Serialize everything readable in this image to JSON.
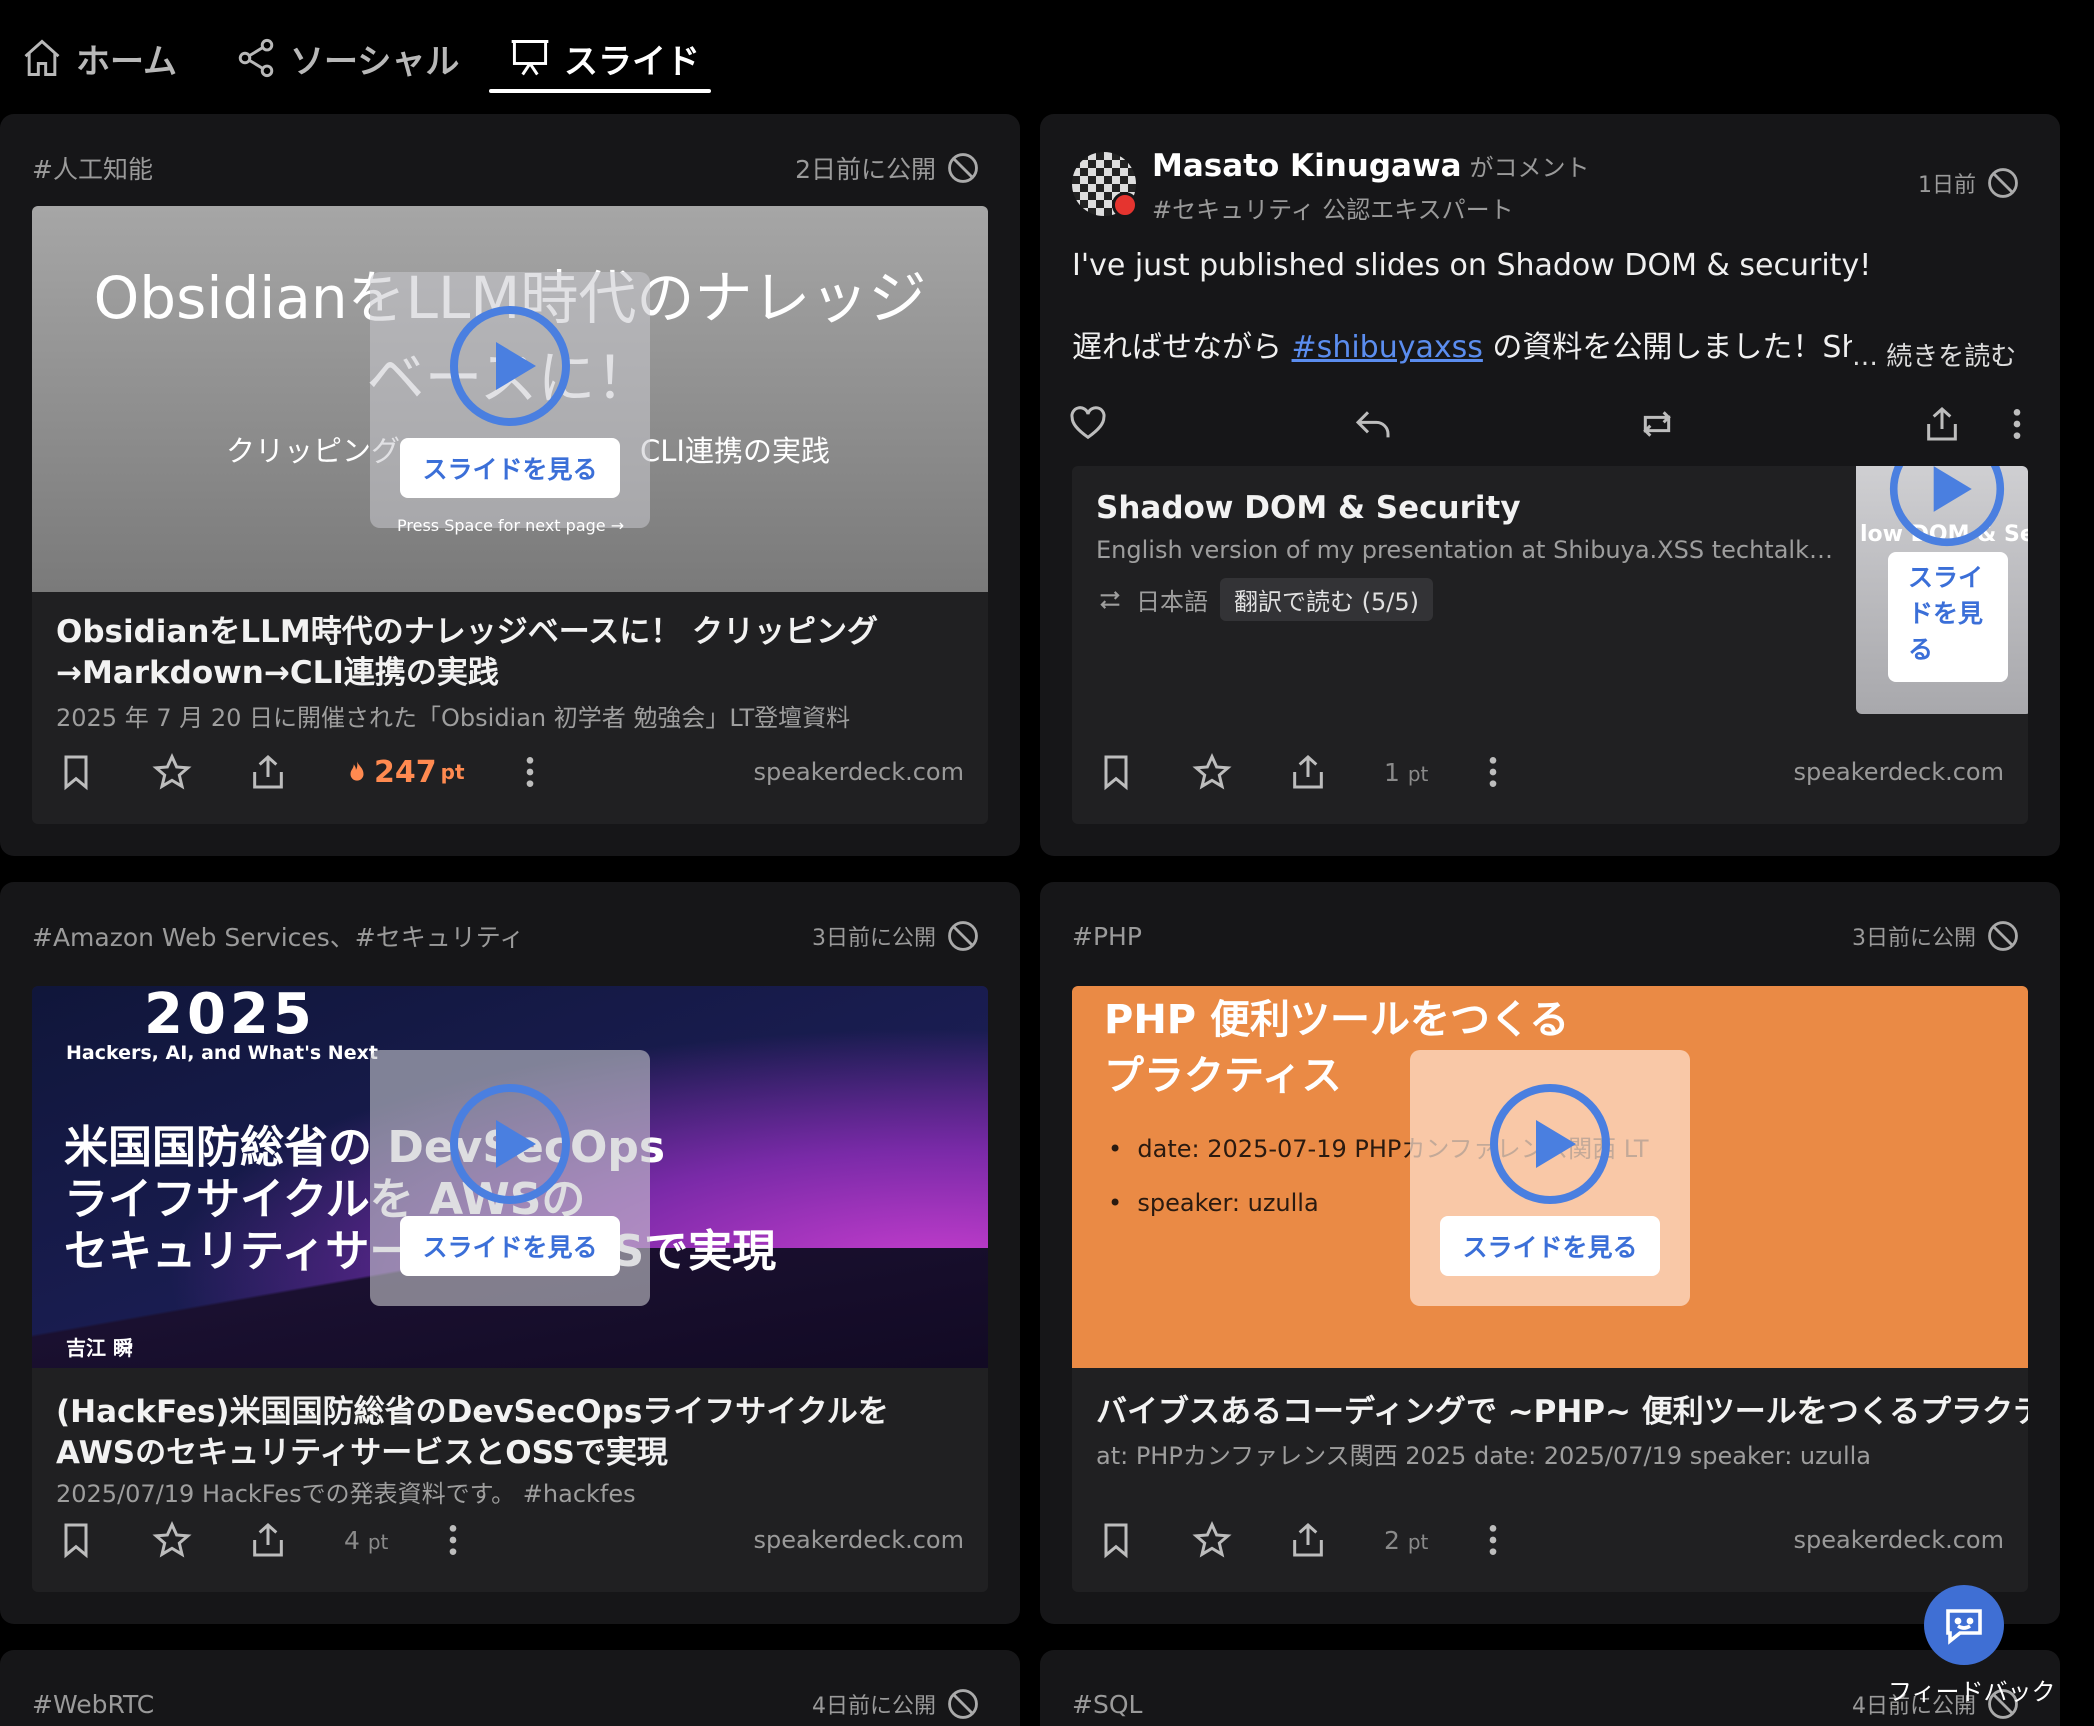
{
  "nav": {
    "tabs": [
      {
        "label": "ホーム",
        "icon": "home-icon"
      },
      {
        "label": "ソーシャル",
        "icon": "share-icon"
      },
      {
        "label": "スライド",
        "icon": "presentation-icon",
        "active": true
      }
    ]
  },
  "cards": [
    {
      "tag": "#人工知能",
      "published": "2日前に公開",
      "thumb_title_1": "ObsidianをLLM時代のナレッジ",
      "thumb_title_2": "ベースに！",
      "thumb_subtitle_left": "クリッピング",
      "thumb_subtitle_right": "CLI連携の実践",
      "thumb_hint": "Press Space for next page →",
      "see_label": "スライドを見る",
      "title": "ObsidianをLLM時代のナレッジベースに！ クリッピング→Markdown→CLI連携の実践",
      "desc": "2025 年 7 月 20 日に開催された「Obsidian 初学者 勉強会」LT登壇資料",
      "points": "247",
      "points_unit": "pt",
      "domain": "speakerdeck.com"
    },
    {
      "author": "Masato Kinugawa",
      "author_action": "がコメント",
      "author_badge": "#セキュリティ 公認エキスパート",
      "time": "1日前",
      "comment_line1": "I've just published slides on Shadow DOM & security!",
      "comment_line2_prefix": "遅ればせながら ",
      "comment_hashtag": "#shibuyaxss",
      "comment_line2_suffix": " の資料を公開しました！Sh",
      "read_more": "… 続きを読む",
      "embed_title": "Shadow DOM & Security",
      "embed_desc": "English version of my presentation at Shibuya.XSS techtalk…",
      "embed_lang": "日本語",
      "embed_translate": "翻訳で読む (5/5)",
      "embed_thumb_text": "low DOM & Secu",
      "embed_see_label": "スライドを見る",
      "points": "1",
      "points_unit": "pt",
      "domain": "speakerdeck.com"
    },
    {
      "tag": "#Amazon Web Services、#セキュリティ",
      "published": "3日前に公開",
      "thumb_year": "2025",
      "thumb_tagline": "Hackers, AI, and What's Next",
      "thumb_line1": "米国国防総省の DevSecOps",
      "thumb_line2": "ライフサイクルを AWSの",
      "thumb_line3": "セキュリティサービスとOSSで実現",
      "thumb_author": "吉江 瞬",
      "see_label": "スライドを見る",
      "title": "(HackFes)米国国防総省のDevSecOpsライフサイクルをAWSのセキュリティサービスとOSSで実現",
      "desc": "2025/07/19 HackFesでの発表資料です。 #hackfes",
      "points": "4",
      "points_unit": "pt",
      "domain": "speakerdeck.com"
    },
    {
      "tag": "#PHP",
      "published": "3日前に公開",
      "thumb_title_1": "PHP 便利ツールをつくる",
      "thumb_title_2": "プラクティス",
      "thumb_bullet_1": "date: 2025-07-19 PHPカンファレンス関西 LT",
      "thumb_bullet_2": "speaker: uzulla",
      "see_label": "スライドを見る",
      "title": "バイブスあるコーディングで ~PHP~ 便利ツールをつくるプラクティス",
      "desc": "at: PHPカンファレンス関西 2025 date: 2025/07/19 speaker: uzulla",
      "points": "2",
      "points_unit": "pt",
      "domain": "speakerdeck.com"
    },
    {
      "tag": "#WebRTC",
      "published": "4日前に公開"
    },
    {
      "tag": "#SQL",
      "published": "4日前に公開"
    }
  ],
  "feedback_label": "フィードバック",
  "colors": {
    "accent": "#3b6fd8",
    "hot": "#ff8a50",
    "php_orange": "#ea8a45",
    "card_bg": "#161618"
  }
}
